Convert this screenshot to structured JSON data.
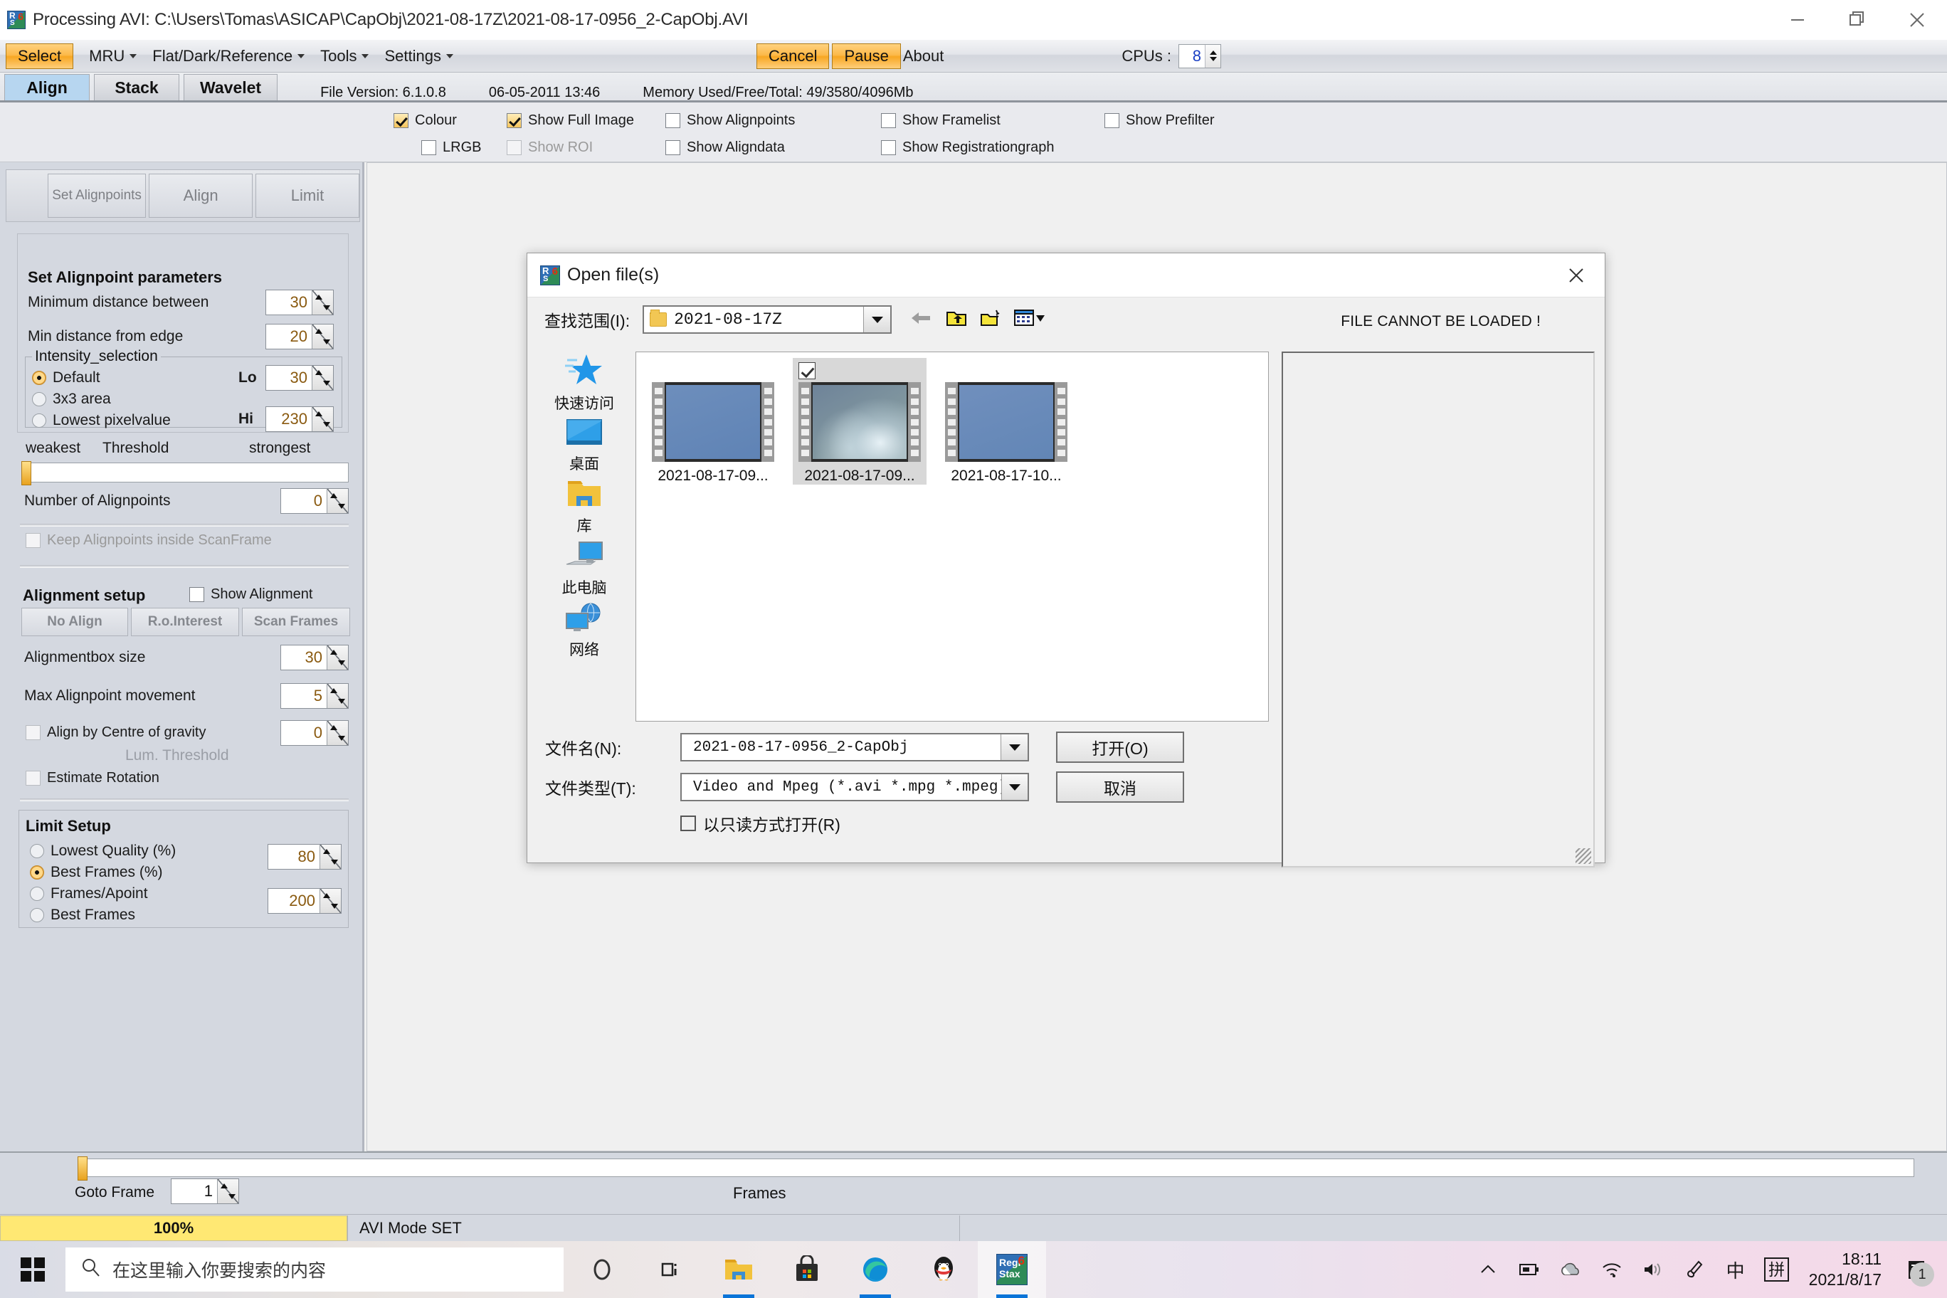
{
  "window": {
    "title": "Processing AVI: C:\\Users\\Tomas\\ASICAP\\CapObj\\2021-08-17Z\\2021-08-17-0956_2-CapObj.AVI",
    "minimize": "–",
    "maximize": "❐",
    "close": "✕"
  },
  "menubar": {
    "select_label": "Select",
    "items": [
      {
        "label": "MRU",
        "caret": true
      },
      {
        "label": "Flat/Dark/Reference",
        "caret": true
      },
      {
        "label": "Tools",
        "caret": true
      },
      {
        "label": "Settings",
        "caret": true
      }
    ],
    "cancel_label": "Cancel",
    "pause_label": "Pause",
    "about_label": "About",
    "cpus_label": "CPUs :",
    "cpus_value": "8"
  },
  "tabs": [
    {
      "label": "Align",
      "active": true
    },
    {
      "label": "Stack",
      "active": false
    },
    {
      "label": "Wavelet",
      "active": false
    }
  ],
  "statusinfo": {
    "file_version": "File Version: 6.1.0.8",
    "date": "06-05-2011 13:46",
    "memory": "Memory Used/Free/Total: 49/3580/4096Mb"
  },
  "checkbar": {
    "row1": [
      {
        "label": "Colour",
        "checked": true,
        "dim": false
      },
      {
        "label": "Show Full Image",
        "checked": true,
        "dim": false
      },
      {
        "label": "Show Alignpoints",
        "checked": false,
        "dim": false
      },
      {
        "label": "Show Framelist",
        "checked": false,
        "dim": false
      },
      {
        "label": "Show Prefilter",
        "checked": false,
        "dim": false
      }
    ],
    "row2": [
      {
        "label": "LRGB",
        "checked": false,
        "dim": false
      },
      {
        "label": "Show ROI",
        "checked": false,
        "dim": true
      },
      {
        "label": "Show Aligndata",
        "checked": false,
        "dim": false
      },
      {
        "label": "Show Registrationgraph",
        "checked": false,
        "dim": false
      }
    ]
  },
  "left_panel": {
    "buttons": [
      {
        "label": "Set Alignpoints"
      },
      {
        "label": "Align"
      },
      {
        "label": "Limit"
      }
    ],
    "alignpoint_params": {
      "title": "Set Alignpoint parameters",
      "min_distance_between_label": "Minimum distance between",
      "min_distance_between_value": "30",
      "min_distance_edge_label": "Min distance from edge",
      "min_distance_edge_value": "20",
      "intensity_legend": "Intensity_selection",
      "radios": [
        {
          "label": "Default",
          "selected": true
        },
        {
          "label": "3x3 area",
          "selected": false
        },
        {
          "label": "Lowest pixelvalue",
          "selected": false
        }
      ],
      "lo_label": "Lo",
      "lo_value": "30",
      "hi_label": "Hi",
      "hi_value": "230"
    },
    "threshold": {
      "weakest": "weakest",
      "title": "Threshold",
      "strongest": "strongest"
    },
    "number_of_alignpoints_label": "Number of Alignpoints",
    "number_of_alignpoints_value": "0",
    "keep_inside_scanframe_label": "Keep Alignpoints inside ScanFrame",
    "alignment_setup": {
      "title": "Alignment setup",
      "show_alignment_label": "Show Alignment",
      "buttons": [
        {
          "label": "No Align"
        },
        {
          "label": "R.o.Interest"
        },
        {
          "label": "Scan Frames"
        }
      ],
      "alignmentbox_size_label": "Alignmentbox size",
      "alignmentbox_size_value": "30",
      "max_movement_label": "Max Alignpoint movement",
      "max_movement_value": "5",
      "centre_gravity_label": "Align by Centre of gravity",
      "centre_gravity_value": "0",
      "lum_threshold_label": "Lum. Threshold",
      "estimate_rotation_label": "Estimate Rotation"
    },
    "limit_setup": {
      "title": "Limit Setup",
      "radios": [
        {
          "label": "Lowest Quality (%)",
          "selected": false
        },
        {
          "label": "Best Frames (%)",
          "selected": true
        },
        {
          "label": "Frames/Apoint",
          "selected": false
        },
        {
          "label": "Best Frames",
          "selected": false
        }
      ],
      "value1": "80",
      "value2": "200"
    }
  },
  "frames_bar": {
    "goto_frame_label": "Goto Frame",
    "goto_frame_value": "1",
    "frames_label": "Frames"
  },
  "status_bar": {
    "progress_text": "100%",
    "status_text": "AVI Mode SET"
  },
  "dialog": {
    "title": "Open file(s)",
    "close_label": "✕",
    "look_in_label": "查找范围(I):",
    "look_in_value": "2021-08-17Z",
    "nav_icons": [
      "back-arrow-icon",
      "up-folder-icon",
      "new-folder-icon",
      "view-mode-icon"
    ],
    "error_text": "FILE CANNOT BE LOADED !",
    "places": [
      {
        "label": "快速访问",
        "icon": "quick-access-star-icon"
      },
      {
        "label": "桌面",
        "icon": "desktop-icon"
      },
      {
        "label": "库",
        "icon": "libraries-folder-icon"
      },
      {
        "label": "此电脑",
        "icon": "this-pc-icon"
      },
      {
        "label": "网络",
        "icon": "network-icon"
      }
    ],
    "files": [
      {
        "name": "2021-08-17-09...",
        "selected": false,
        "checked": false,
        "thumb": "sky"
      },
      {
        "name": "2021-08-17-09...",
        "selected": true,
        "checked": true,
        "thumb": "moon"
      },
      {
        "name": "2021-08-17-10...",
        "selected": false,
        "checked": false,
        "thumb": "sky"
      }
    ],
    "filename_label": "文件名(N):",
    "filename_value": "2021-08-17-0956_2-CapObj",
    "filetype_label": "文件类型(T):",
    "filetype_value": "Video and Mpeg (*.avi *.mpg *.mpeg)",
    "open_button": "打开(O)",
    "cancel_button": "取消",
    "readonly_label": "以只读方式打开(R)"
  },
  "taskbar": {
    "search_placeholder": "在这里输入你要搜索的内容",
    "apps": [
      {
        "name": "cortana-icon"
      },
      {
        "name": "task-view-icon"
      },
      {
        "name": "file-explorer-icon"
      },
      {
        "name": "microsoft-store-icon"
      },
      {
        "name": "edge-icon"
      },
      {
        "name": "qq-icon"
      },
      {
        "name": "registax-icon"
      }
    ],
    "tray": [
      "^",
      "battery-icon",
      "onedrive-icon",
      "wifi-icon",
      "volume-icon",
      "pen-icon"
    ],
    "ime_mode": "中",
    "ime_pinyin": "拼",
    "time": "18:11",
    "date": "2021/8/17",
    "notification_count": "1"
  },
  "colors": {
    "accent_orange": "#f7a723",
    "tab_active": "#b7d6f0",
    "panel_bg": "#d4d8e0",
    "progress_yellow": "#ffe873"
  }
}
